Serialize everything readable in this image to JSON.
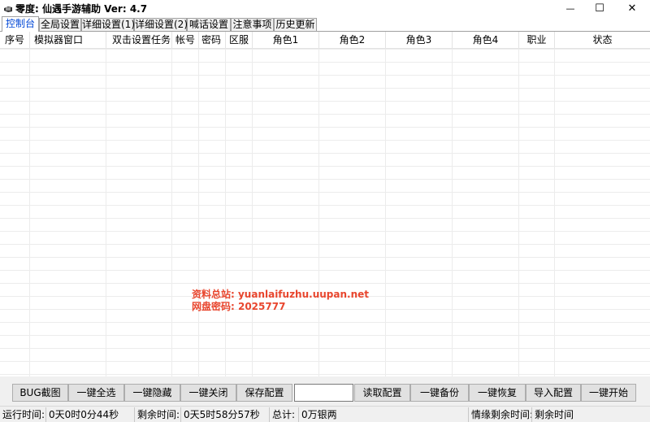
{
  "window": {
    "title": "零度: 仙遇手游辅助 Ver:  4.7",
    "app_icon": "hand-pointer-icon",
    "minimize_glyph": "—",
    "maximize_glyph": "☐",
    "close_glyph": "✕"
  },
  "tabs": [
    {
      "label": "控制台",
      "active": true
    },
    {
      "label": "全局设置",
      "active": false
    },
    {
      "label": "详细设置(1)",
      "active": false
    },
    {
      "label": "详细设置(2)",
      "active": false
    },
    {
      "label": "喊话设置",
      "active": false
    },
    {
      "label": "注意事项",
      "active": false
    },
    {
      "label": "历史更新",
      "active": false
    }
  ],
  "grid": {
    "columns": [
      "序号",
      "模拟器窗口",
      "双击设置任务",
      "帐号",
      "密码",
      "区服",
      "角色1",
      "角色2",
      "角色3",
      "角色4",
      "职业",
      "状态"
    ]
  },
  "watermark": {
    "line1": "资料总站: yuanlaifuzhu.uupan.net",
    "line2": "网盘密码: 2025777"
  },
  "buttons": {
    "bug_screenshot": "BUG截图",
    "select_all": "一键全选",
    "hide_all": "一键隐藏",
    "close_all": "一键关闭",
    "save_config": "保存配置",
    "config_name_value": "",
    "read_config": "读取配置",
    "backup": "一键备份",
    "restore": "一键恢复",
    "import_config": "导入配置",
    "start_all": "一键开始"
  },
  "status": {
    "runtime_label": "运行时间:",
    "runtime_value": "0天0时0分44秒",
    "remaining_label": "剩余时间:",
    "remaining_value": "0天5时58分57秒",
    "total_label": "总计:",
    "total_value": "0万银两",
    "emotion_label": "情缘剩余时间:",
    "emotion_value": "剩余时间"
  },
  "colors": {
    "active_tab_text": "#0046d5",
    "watermark": "#e8462e"
  }
}
